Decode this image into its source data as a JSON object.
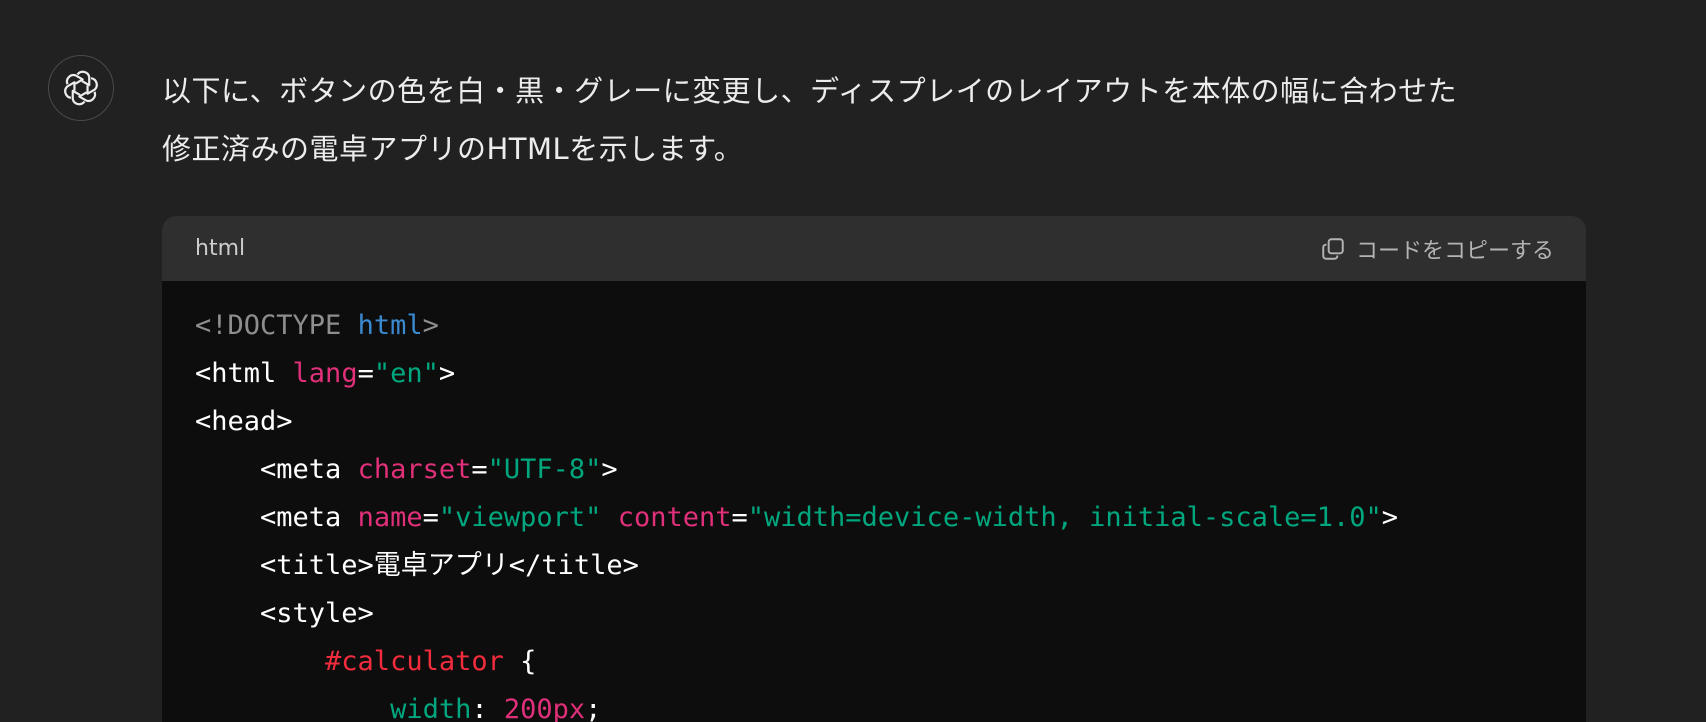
{
  "message": {
    "text": "以下に、ボタンの色を白・黒・グレーに変更し、ディスプレイのレイアウトを本体の幅に合わせた\n修正済みの電卓アプリのHTMLを示します。"
  },
  "code_block": {
    "language": "html",
    "copy_label": "コードをコピーする",
    "lines": [
      [
        {
          "t": "<!DOCTYPE ",
          "c": "gray"
        },
        {
          "t": "html",
          "c": "kw"
        },
        {
          "t": ">",
          "c": "gray"
        }
      ],
      [
        {
          "t": "<html ",
          "c": "plain"
        },
        {
          "t": "lang",
          "c": "attr"
        },
        {
          "t": "=",
          "c": "plain"
        },
        {
          "t": "\"en\"",
          "c": "str"
        },
        {
          "t": ">",
          "c": "plain"
        }
      ],
      [
        {
          "t": "<head>",
          "c": "plain"
        }
      ],
      [
        {
          "t": "    <meta ",
          "c": "plain"
        },
        {
          "t": "charset",
          "c": "attr"
        },
        {
          "t": "=",
          "c": "plain"
        },
        {
          "t": "\"UTF-8\"",
          "c": "str"
        },
        {
          "t": ">",
          "c": "plain"
        }
      ],
      [
        {
          "t": "    <meta ",
          "c": "plain"
        },
        {
          "t": "name",
          "c": "attr"
        },
        {
          "t": "=",
          "c": "plain"
        },
        {
          "t": "\"viewport\"",
          "c": "str"
        },
        {
          "t": " ",
          "c": "plain"
        },
        {
          "t": "content",
          "c": "attr"
        },
        {
          "t": "=",
          "c": "plain"
        },
        {
          "t": "\"width=device-width, initial-scale=1.0\"",
          "c": "str"
        },
        {
          "t": ">",
          "c": "plain"
        }
      ],
      [
        {
          "t": "    <title>電卓アプリ</title>",
          "c": "plain"
        }
      ],
      [
        {
          "t": "    <style>",
          "c": "plain"
        }
      ],
      [
        {
          "t": "        #calculator",
          "c": "sel"
        },
        {
          "t": " {",
          "c": "plain"
        }
      ],
      [
        {
          "t": "            width",
          "c": "str"
        },
        {
          "t": ": ",
          "c": "plain"
        },
        {
          "t": "200px",
          "c": "num"
        },
        {
          "t": ";",
          "c": "plain"
        }
      ]
    ]
  },
  "colors": {
    "background": "#212121",
    "code_header": "#2f2f2f",
    "code_background": "#0d0d0d",
    "string": "#00a67d",
    "attribute": "#df3079",
    "keyword": "#3b8ad1",
    "selector": "#f22c3d"
  },
  "icons": {
    "avatar": "openai-logo-icon",
    "copy": "copy-icon"
  }
}
